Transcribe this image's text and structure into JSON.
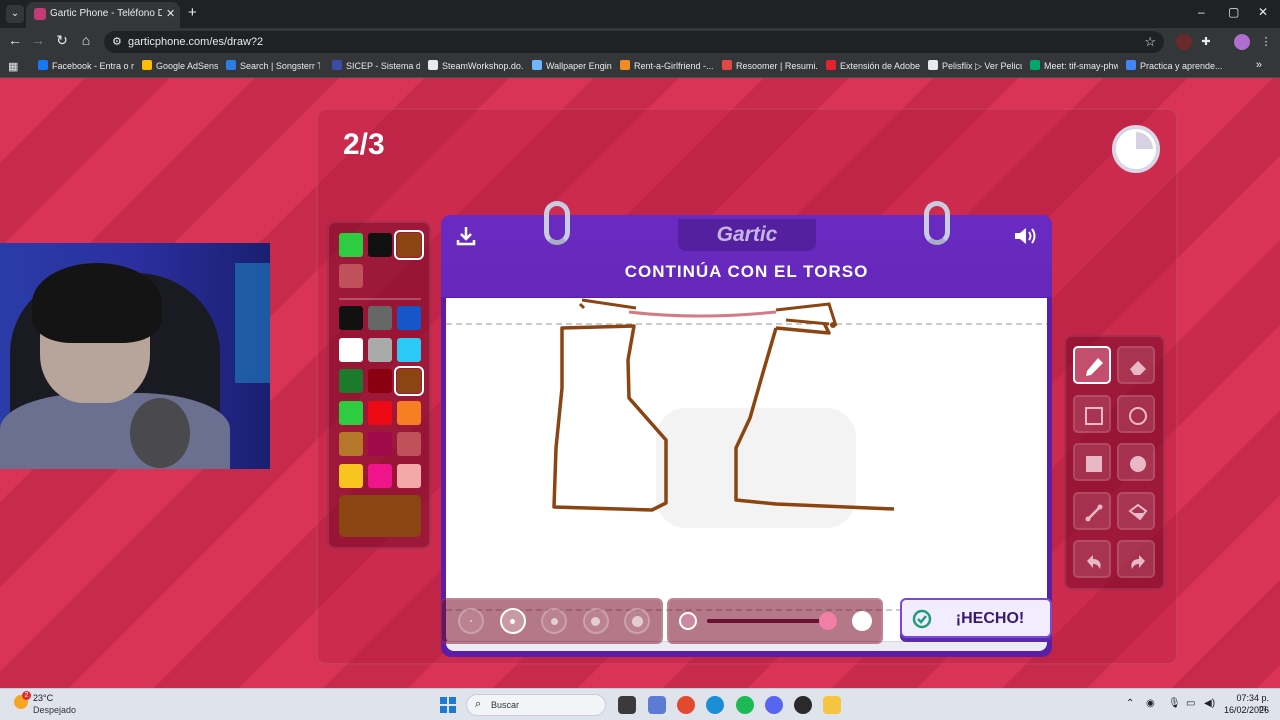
{
  "browser": {
    "tab_title": "Gartic Phone - Teléfono Descon...",
    "tab_close": "✕",
    "new_tab": "+",
    "url": "garticphone.com/es/draw?2",
    "win_min": "–",
    "win_max": "▢",
    "win_close": "✕"
  },
  "bookmarks": [
    {
      "label": "Facebook - Entra o r...",
      "color": "#1877f2"
    },
    {
      "label": "Google AdSense",
      "color": "#fbbc04"
    },
    {
      "label": "Search | Songsterr T...",
      "color": "#2a7de1"
    },
    {
      "label": "SICEP - Sistema de...",
      "color": "#3d4aa8"
    },
    {
      "label": "SteamWorkshop.do...",
      "color": "#e8eaed"
    },
    {
      "label": "Wallpaper Engine",
      "color": "#6fb6ff"
    },
    {
      "label": "Rent-a-Girlfriend -...",
      "color": "#f08a24"
    },
    {
      "label": "Resoomer | Resumi...",
      "color": "#e04848"
    },
    {
      "label": "Extensión de Adobe...",
      "color": "#e3232f"
    },
    {
      "label": "Pelisflix ▷ Ver Pelicu...",
      "color": "#e8eaed"
    },
    {
      "label": "Meet: tif-smay-phw",
      "color": "#00a86b"
    },
    {
      "label": "Practica y aprende...",
      "color": "#4285f4"
    }
  ],
  "game": {
    "round": "2/3",
    "logo": "Gartic",
    "prompt": "CONTINÚA CON EL TORSO",
    "done_label": "¡HECHO!",
    "timer_remaining_fraction": 0.75,
    "selected_tool": "pencil",
    "selected_size_index": 1,
    "opacity_fraction": 0.93,
    "current_color": "#8b4513"
  },
  "palette": {
    "recent": [
      "#2ecc40",
      "#111111",
      "#8b4513",
      "#c0505a"
    ],
    "colors": [
      "#111111",
      "#666666",
      "#1656c8",
      "#ffffff",
      "#aaaaaa",
      "#2ccbf5",
      "#1c7a2c",
      "#8a0010",
      "#8b4513",
      "#2ecc40",
      "#ee0a14",
      "#f57f22",
      "#b5782a",
      "#a00a4a",
      "#c0505a",
      "#f7c420",
      "#f0148a",
      "#f5a8a8"
    ]
  },
  "tools": [
    "pencil",
    "eraser",
    "rectangle-outline",
    "circle-outline",
    "rectangle-filled",
    "circle-filled",
    "line",
    "fill-bucket",
    "undo",
    "redo"
  ],
  "taskbar": {
    "temperature": "23°C",
    "weather": "Despejado",
    "weather_badge": "2",
    "search_placeholder": "Buscar",
    "time": "07:34 p. m.",
    "date": "16/02/2026"
  }
}
